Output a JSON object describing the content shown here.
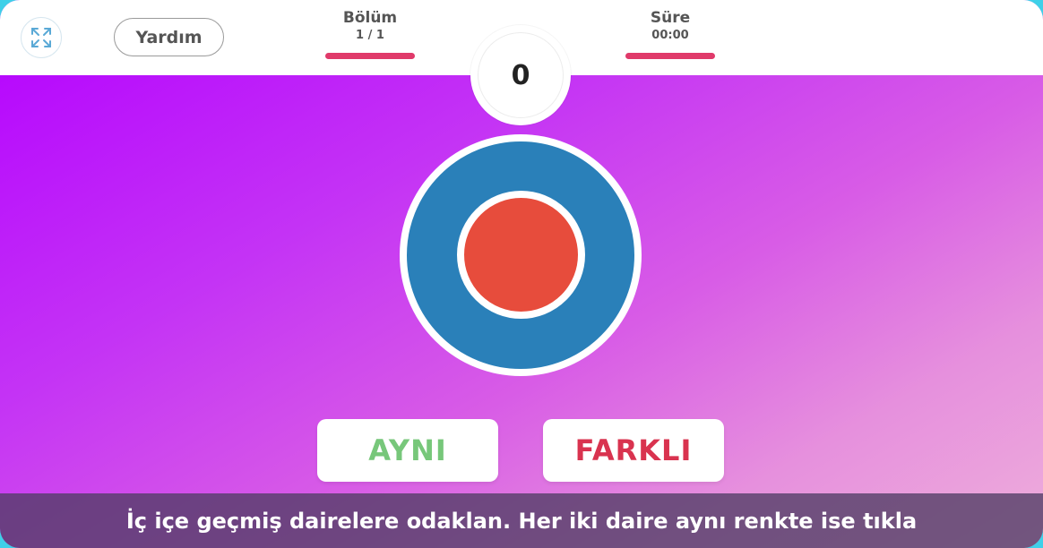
{
  "header": {
    "fullscreen_icon": "expand-icon",
    "help_label": "Yardım",
    "level_label": "Bölüm",
    "level_value": "1 / 1",
    "time_label": "Süre",
    "time_value": "00:00",
    "score": "0"
  },
  "game": {
    "outer_circle_color": "#2a80b9",
    "inner_circle_color": "#e74c3c"
  },
  "buttons": {
    "same_label": "AYNI",
    "same_color": "#77c77a",
    "different_label": "FARKLI",
    "different_color": "#d9334f"
  },
  "instruction": "İç içe geçmiş dairelere odaklan. Her iki daire aynı renkte ise tıkla",
  "colors": {
    "accent_bar": "#e03a6a",
    "background_start": "#b400ff",
    "background_end": "#eeaedc"
  }
}
